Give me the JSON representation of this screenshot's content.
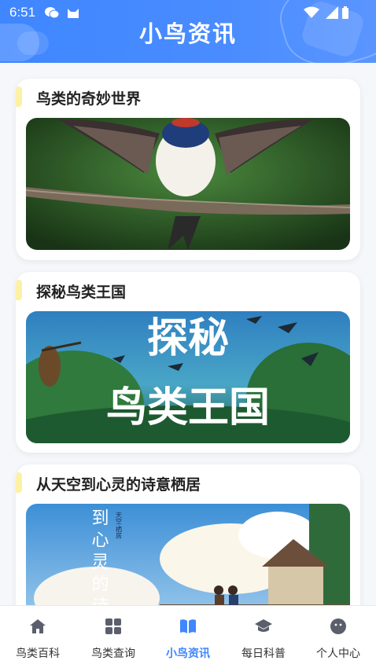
{
  "status_bar": {
    "time": "6:51"
  },
  "header": {
    "title": "小鸟资讯"
  },
  "articles": [
    {
      "title": "鸟类的奇妙世界",
      "image": "swallow-on-branch"
    },
    {
      "title": "探秘鸟类王国",
      "image": "bird-kingdom-poster",
      "poster_line1": "探秘",
      "poster_line2": "鸟类王国"
    },
    {
      "title": "从天空到心灵的诗意栖居",
      "image": "sky-poem-poster",
      "poster_text": "到心灵的诗",
      "poster_small": "天空·栖居"
    }
  ],
  "tabs": [
    {
      "label": "鸟类百科",
      "icon": "home-icon"
    },
    {
      "label": "鸟类查询",
      "icon": "grid-icon"
    },
    {
      "label": "小鸟资讯",
      "icon": "book-icon",
      "active": true
    },
    {
      "label": "每日科普",
      "icon": "graduation-cap-icon"
    },
    {
      "label": "个人中心",
      "icon": "chat-face-icon"
    }
  ],
  "colors": {
    "accent": "#3f86ff",
    "header_bg": "#4a8cff",
    "title_marker": "#fdf1a6"
  }
}
